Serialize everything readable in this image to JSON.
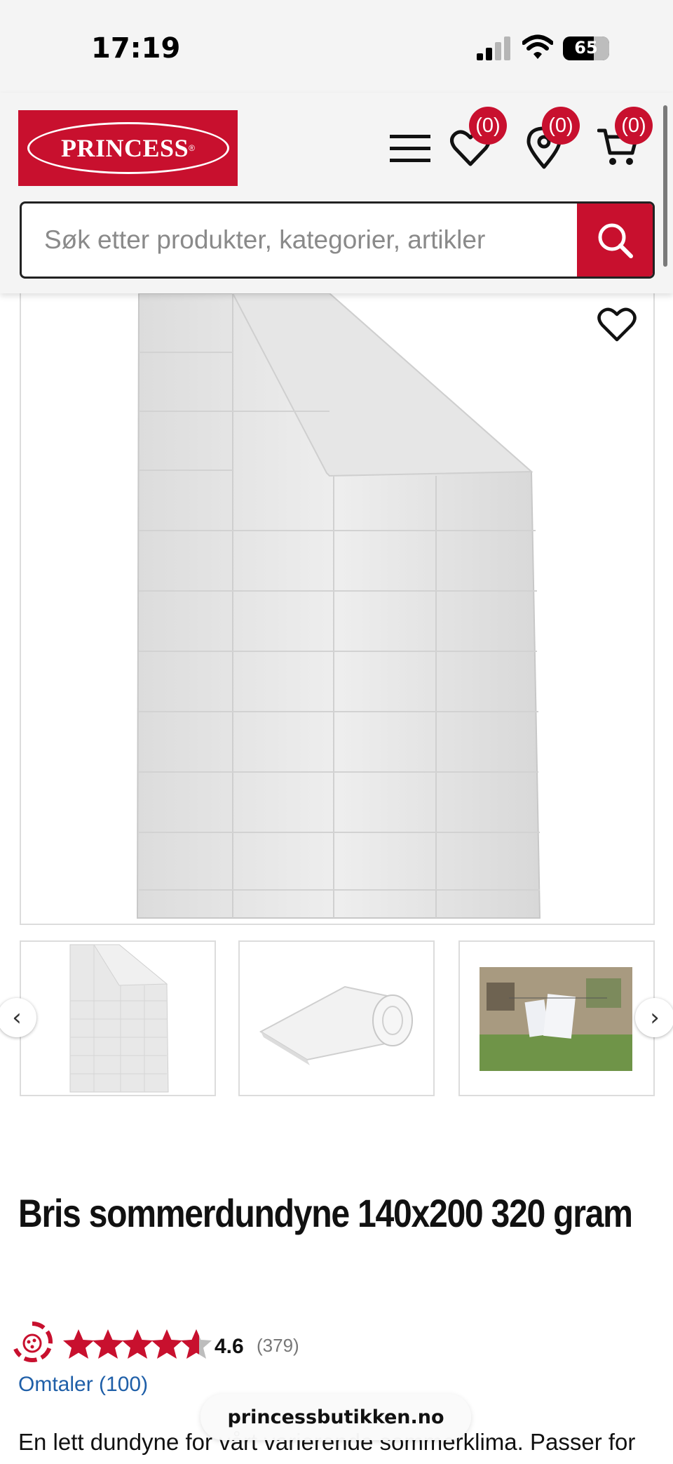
{
  "status_bar": {
    "time": "17:19",
    "battery": "65"
  },
  "header": {
    "logo_text": "PRINCESS",
    "logo_registered": "®",
    "wishlist_count": "(0)",
    "stores_count": "(0)",
    "cart_count": "(0)"
  },
  "search": {
    "placeholder": "Søk etter produkter, kategorier, artikler"
  },
  "gallery": {
    "prev_label": "‹",
    "next_label": "›"
  },
  "product": {
    "title": "Bris sommerdundyne 140x200 320 gram",
    "rating": "4.6",
    "rating_count": "(379)",
    "rating_stars": 4.6,
    "reviews_link": "Omtaler (100)",
    "description": "En lett dundyne for vårt varierende sommerklima. Passer for"
  },
  "browser": {
    "url": "princessbutikken.no"
  },
  "colors": {
    "brand": "#c8102e",
    "link": "#1f5fa8"
  }
}
